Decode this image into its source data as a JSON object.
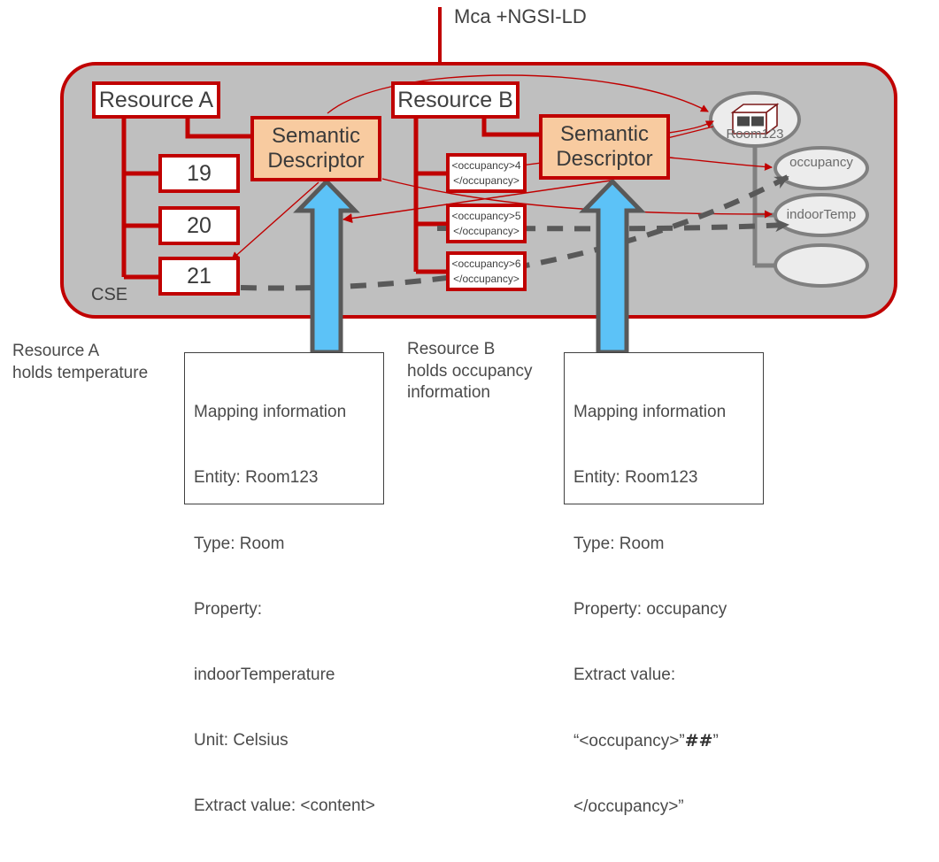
{
  "diagram": {
    "top_label": "Mca +NGSI-LD",
    "container_label": "CSE",
    "resource_a": {
      "title": "Resource A",
      "values": [
        "19",
        "20",
        "21"
      ]
    },
    "resource_b": {
      "title": "Resource B",
      "values": [
        {
          "line1": "<occupancy>4",
          "line2": "</occupancy>"
        },
        {
          "line1": "<occupancy>5",
          "line2": "</occupancy>"
        },
        {
          "line1": "<occupancy>6",
          "line2": "</occupancy>"
        }
      ]
    },
    "semantic_descriptor_a": {
      "line1": "Semantic",
      "line2": "Descriptor"
    },
    "semantic_descriptor_b": {
      "line1": "Semantic",
      "line2": "Descriptor"
    },
    "entity": {
      "label": "Room123",
      "icon": "box-3d-icon"
    },
    "properties": [
      {
        "label": "occupancy"
      },
      {
        "label": "indoorTemp"
      },
      {
        "label": ""
      }
    ],
    "captions": {
      "left": "Resource A\nholds temperature",
      "middle": "Resource B\nholds occupancy\ninformation"
    },
    "mapping_a": {
      "title": "Mapping information",
      "entity": "Entity: Room123",
      "type": "Type: Room",
      "property_label": "Property:",
      "property_value": "indoorTemperature",
      "unit": "Unit: Celsius",
      "extract": "Extract value: <content>"
    },
    "mapping_b": {
      "title": "Mapping information",
      "entity": "Entity: Room123",
      "type": "Type: Room",
      "property": "Property: occupancy",
      "extract_label": "Extract value:",
      "extract_prefix": "“<occupancy>”",
      "extract_hash": "##",
      "extract_quote": "”",
      "extract_suffix": "</occupancy>”"
    },
    "colors": {
      "red": "#C00000",
      "container_fill": "#BFBFBF",
      "descriptor_fill": "#F8CBA0",
      "arrow_blue": "#5CC2F7",
      "arrow_outline": "#595959",
      "ellipse_fill": "#ECECEC",
      "ellipse_stroke": "#808080",
      "text": "#404040"
    }
  }
}
